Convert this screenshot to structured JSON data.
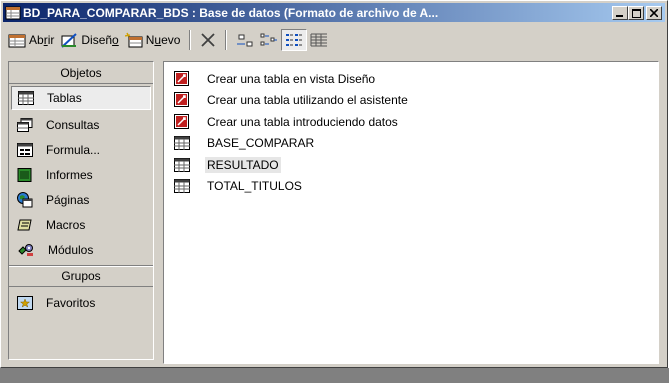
{
  "window": {
    "title": "BD_PARA_COMPARAR_BDS : Base de datos (Formato de archivo de A...",
    "controls": [
      "minimize-icon",
      "restore-icon",
      "close-icon"
    ]
  },
  "toolbar": {
    "open_label": "Abrir",
    "design_label": "Diseño",
    "new_label": "Nuevo",
    "icons": [
      "open-icon",
      "design-icon",
      "new-icon",
      "delete-icon",
      "large-icons-icon",
      "small-icons-icon",
      "list-view-icon",
      "details-view-icon"
    ]
  },
  "objects_panel": {
    "header": "Objetos",
    "items": [
      {
        "label": "Tablas",
        "icon": "table-icon",
        "selected": true
      },
      {
        "label": "Consultas",
        "icon": "query-icon",
        "selected": false
      },
      {
        "label": "Formula...",
        "icon": "form-icon",
        "selected": false
      },
      {
        "label": "Informes",
        "icon": "report-icon",
        "selected": false
      },
      {
        "label": "Páginas",
        "icon": "page-icon",
        "selected": false
      },
      {
        "label": "Macros",
        "icon": "macro-icon",
        "selected": false
      },
      {
        "label": "Módulos",
        "icon": "module-icon",
        "selected": false
      }
    ],
    "groups_header": "Grupos",
    "groups": [
      {
        "label": "Favoritos",
        "icon": "favorites-icon"
      }
    ]
  },
  "list": {
    "items": [
      {
        "label": "Crear una tabla en vista Diseño",
        "icon": "wizard-shortcut-icon",
        "selected": false
      },
      {
        "label": "Crear una tabla utilizando el asistente",
        "icon": "wizard-shortcut-icon",
        "selected": false
      },
      {
        "label": "Crear una tabla introduciendo datos",
        "icon": "wizard-shortcut-icon",
        "selected": false
      },
      {
        "label": "BASE_COMPARAR",
        "icon": "table-icon",
        "selected": false
      },
      {
        "label": "RESULTADO",
        "icon": "table-icon",
        "selected": true
      },
      {
        "label": "TOTAL_TITULOS",
        "icon": "table-icon",
        "selected": false
      }
    ]
  },
  "colors": {
    "titlebar_start": "#0a246a",
    "titlebar_end": "#a6caf0",
    "face": "#d4d0c8"
  }
}
